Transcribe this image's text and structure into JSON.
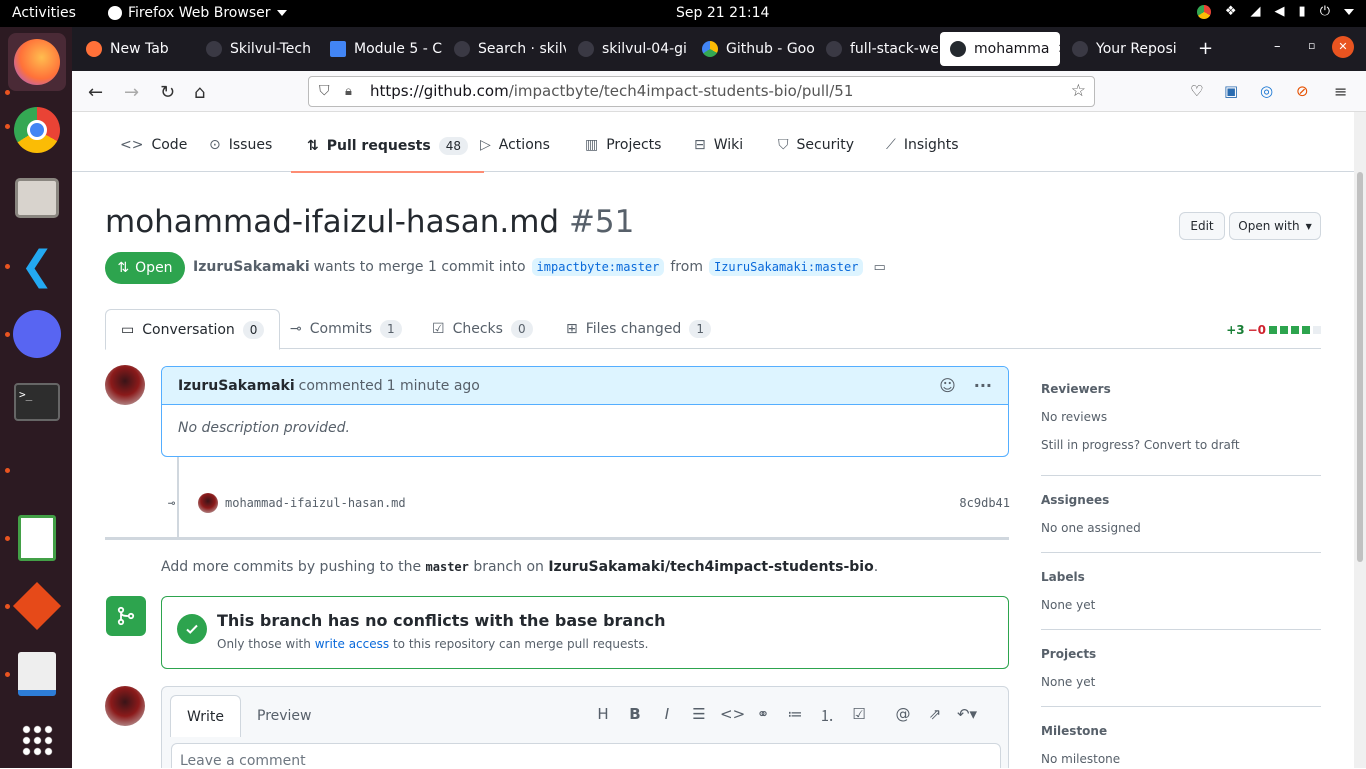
{
  "os": {
    "activities": "Activities",
    "app_menu": "Firefox Web Browser",
    "clock": "Sep 21  21:14"
  },
  "browser": {
    "tabs": [
      {
        "label": "New Tab",
        "color": "#ff7139"
      },
      {
        "label": "Skilvul-Tech",
        "color": "#24292f"
      },
      {
        "label": "Module 5 - C",
        "color": "#4285f4"
      },
      {
        "label": "Search · skilv",
        "color": "#24292f"
      },
      {
        "label": "skilvul-04-gi",
        "color": "#24292f"
      },
      {
        "label": "Github - Goo",
        "color": "#0f9d58"
      },
      {
        "label": "full-stack-we",
        "color": "#24292f"
      },
      {
        "label": "mohamma",
        "color": "#24292f"
      },
      {
        "label": "Your Reposi",
        "color": "#24292f"
      }
    ],
    "url_host": "https://github.com",
    "url_path": "/impactbyte/tech4impact-students-bio/pull/51"
  },
  "repo_nav": {
    "code": "Code",
    "issues": "Issues",
    "pull_requests": "Pull requests",
    "pr_count": "48",
    "actions": "Actions",
    "projects": "Projects",
    "wiki": "Wiki",
    "security": "Security",
    "insights": "Insights"
  },
  "pr": {
    "title": "mohammad-ifaizul-hasan.md",
    "number": "#51",
    "edit": "Edit",
    "open_with": "Open with",
    "state": "Open",
    "author": "IzuruSakamaki",
    "merge_text": "wants to merge 1 commit into",
    "base": "impactbyte:master",
    "from": "from",
    "head": "IzuruSakamaki:master"
  },
  "pr_tabs": {
    "conversation": "Conversation",
    "conversation_count": "0",
    "commits": "Commits",
    "commits_count": "1",
    "checks": "Checks",
    "checks_count": "0",
    "files": "Files changed",
    "files_count": "1",
    "additions": "+3",
    "deletions": "−0"
  },
  "comment": {
    "author": "IzuruSakamaki",
    "action": "commented",
    "time": "1 minute ago",
    "body": "No description provided."
  },
  "commit": {
    "message": "mohammad-ifaizul-hasan.md",
    "sha": "8c9db41"
  },
  "add_more": {
    "pre": "Add more commits by pushing to the",
    "branch": "master",
    "mid": "branch on",
    "repo": "IzuruSakamaki/tech4impact-students-bio",
    "end": "."
  },
  "merge": {
    "title": "This branch has no conflicts with the base branch",
    "pre": "Only those with",
    "link": "write access",
    "post": "to this repository can merge pull requests."
  },
  "editor": {
    "write": "Write",
    "preview": "Preview",
    "placeholder": "Leave a comment"
  },
  "sidebar": {
    "reviewers": "Reviewers",
    "reviewers_value": "No reviews",
    "reviewers_hint": "Still in progress? Convert to draft",
    "assignees": "Assignees",
    "assignees_value": "No one assigned",
    "labels": "Labels",
    "labels_value": "None yet",
    "projects": "Projects",
    "projects_value": "None yet",
    "milestone": "Milestone",
    "milestone_value": "No milestone"
  }
}
